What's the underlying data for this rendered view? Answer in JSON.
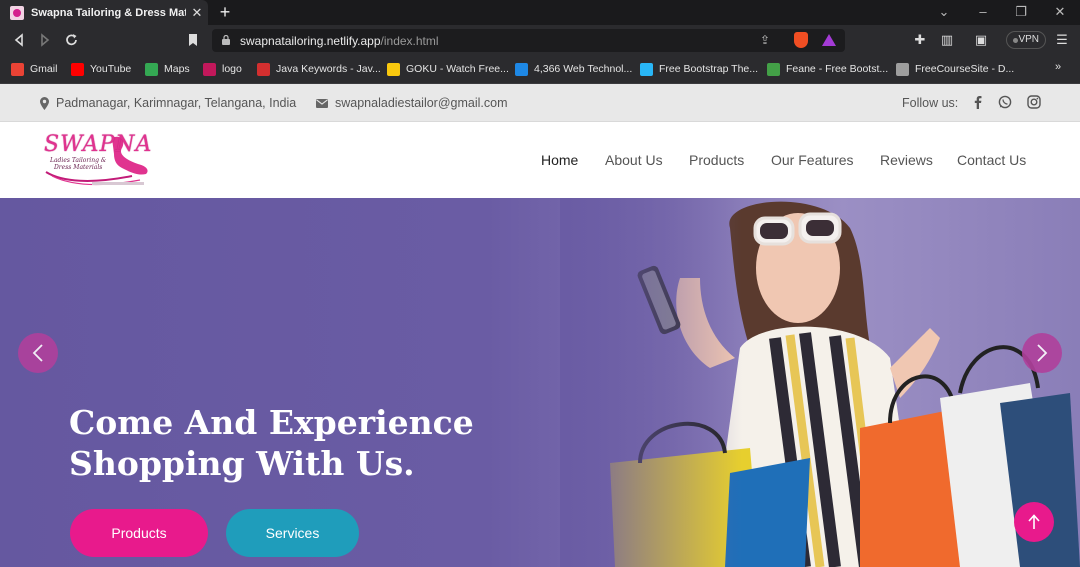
{
  "browser": {
    "tab_title": "Swapna Tailoring & Dress Materials",
    "url_host": "swapnatailoring.netlify.app",
    "url_path": "/index.html",
    "vpn_label": "VPN",
    "bookmarks": [
      {
        "label": "Gmail",
        "icon": "gmail-icon",
        "color": "#ea4335"
      },
      {
        "label": "YouTube",
        "icon": "youtube-icon",
        "color": "#ff0000"
      },
      {
        "label": "Maps",
        "icon": "maps-icon",
        "color": "#34a853"
      },
      {
        "label": "logo",
        "icon": "logo-bookmark-icon",
        "color": "#c2185b"
      },
      {
        "label": "Java Keywords - Jav...",
        "icon": "javatpoint-icon",
        "color": "#d32f2f"
      },
      {
        "label": "GOKU - Watch Free...",
        "icon": "goku-icon",
        "color": "#f9c80e"
      },
      {
        "label": "4,366 Web Technol...",
        "icon": "web-tech-icon",
        "color": "#1e88e5"
      },
      {
        "label": "Free Bootstrap The...",
        "icon": "bootstrap-icon",
        "color": "#29b6f6"
      },
      {
        "label": "Feane - Free Bootst...",
        "icon": "feane-icon",
        "color": "#43a047"
      },
      {
        "label": "FreeCourseSite - D...",
        "icon": "globe-icon",
        "color": "#9e9e9e"
      }
    ],
    "more_bookmarks": "»"
  },
  "topbar": {
    "address": "Padmanagar, Karimnagar, Telangana, India",
    "email": "swapnaladiestailor@gmail.com",
    "follow_label": "Follow us:"
  },
  "logo": {
    "brand": "SWAPNA",
    "line1": "Ladies Tailoring &",
    "line2": "Dress Materials"
  },
  "nav": {
    "items": [
      "Home",
      "About Us",
      "Products",
      "Our Features",
      "Reviews",
      "Contact Us"
    ],
    "active": "Home"
  },
  "hero": {
    "title": "Come And Experience Shopping With Us.",
    "buttons": {
      "products": "Products",
      "services": "Services"
    }
  },
  "colors": {
    "accent_pink": "#e81a8c",
    "accent_teal": "#1f9dbb",
    "hero_overlay": "#6a5ca4"
  }
}
